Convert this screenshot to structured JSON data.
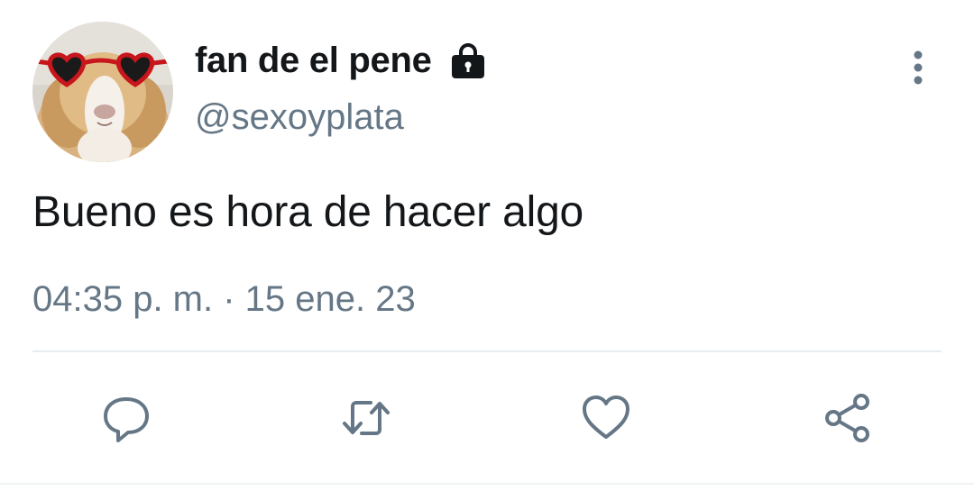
{
  "tweet": {
    "author": {
      "display_name": "fan de el pene",
      "handle": "@sexoyplata",
      "protected_icon": "lock-icon",
      "avatar_icon": "guinea-pig-with-heart-sunglasses"
    },
    "text": "Bueno es hora de hacer algo",
    "timestamp": "04:35 p. m. · 15 ene. 23",
    "menu_icon": "more-vertical-icon",
    "actions": [
      {
        "name": "reply",
        "icon": "reply-icon"
      },
      {
        "name": "retweet",
        "icon": "retweet-icon"
      },
      {
        "name": "like",
        "icon": "heart-icon"
      },
      {
        "name": "share",
        "icon": "share-icon"
      }
    ]
  },
  "colors": {
    "text_primary": "#14171a",
    "text_secondary": "#657786",
    "icon_gray": "#657786",
    "divider": "#e6ecf0",
    "sunglasses_red": "#c8161d"
  }
}
